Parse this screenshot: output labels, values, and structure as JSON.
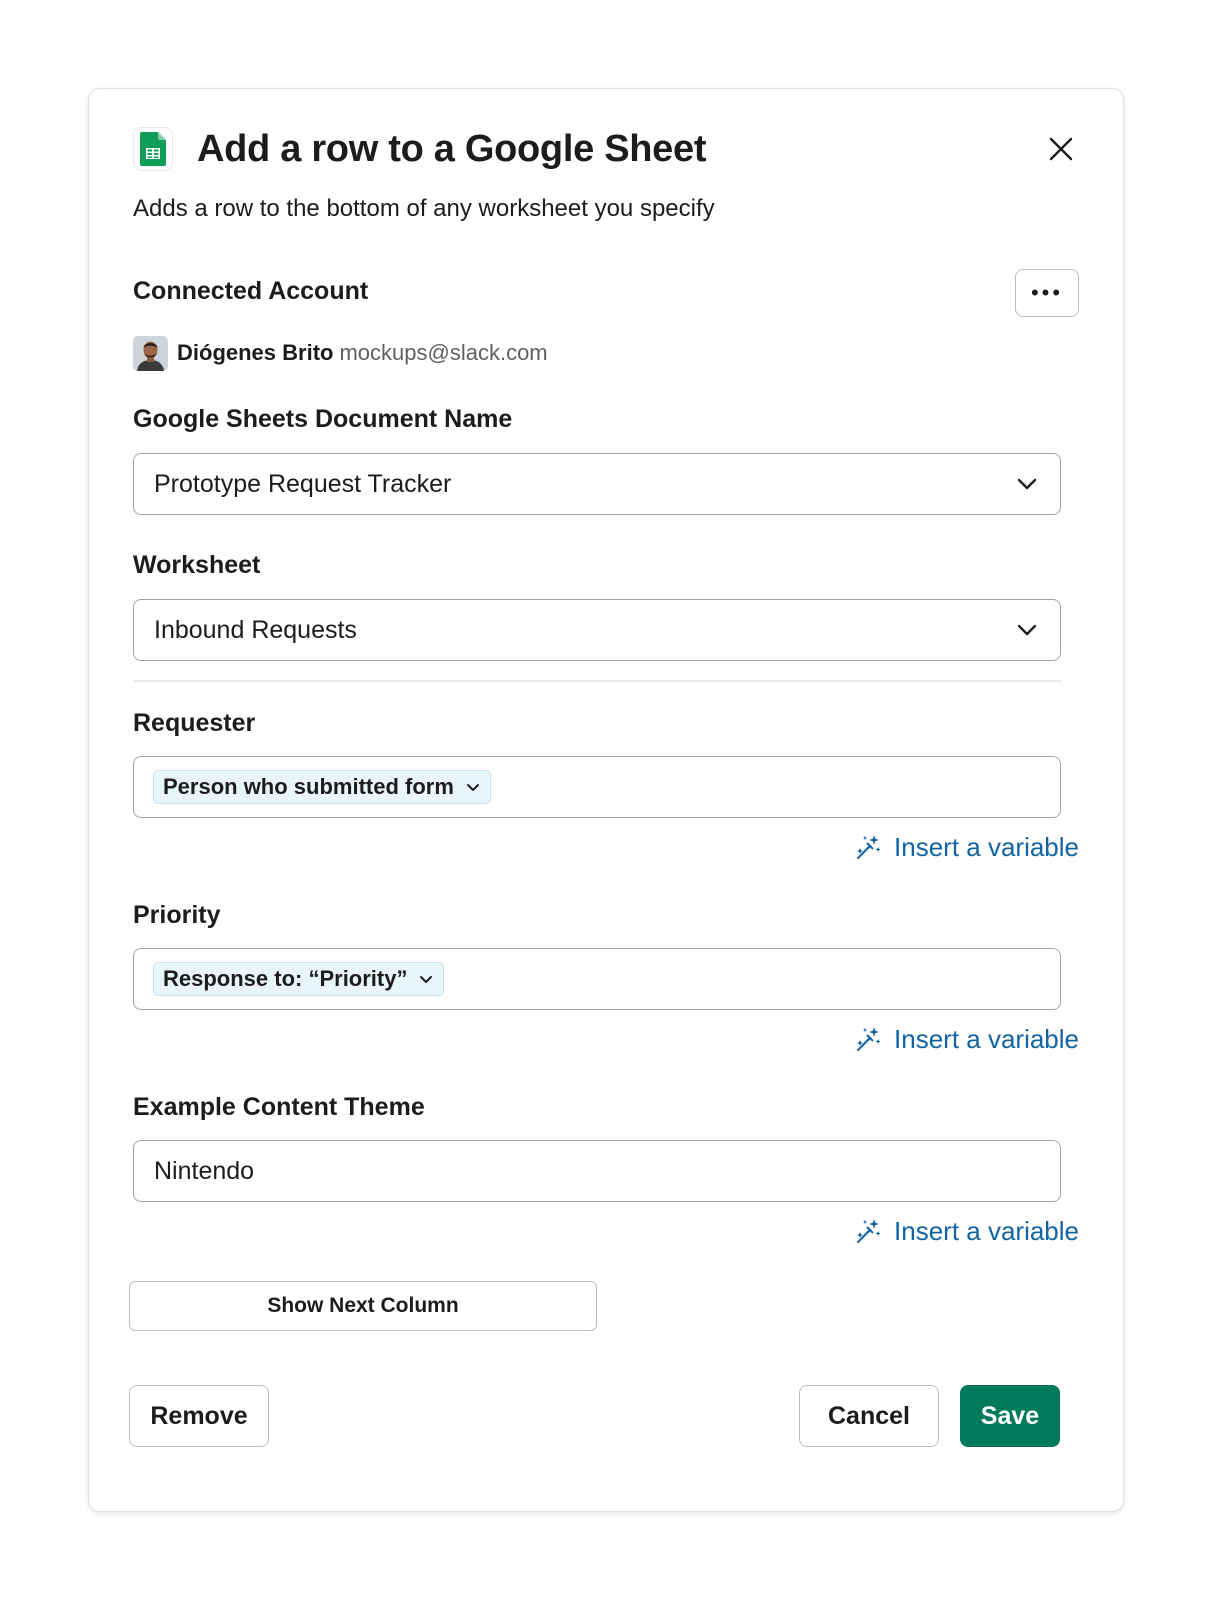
{
  "modal": {
    "title": "Add a row to a Google Sheet",
    "subtitle": "Adds a row to the bottom of any worksheet you specify",
    "app_icon": "google-sheets-icon",
    "close_icon": "close-icon"
  },
  "connected_account": {
    "label": "Connected Account",
    "more_label": "•••",
    "name": "Diógenes Brito",
    "email": "mockups@slack.com"
  },
  "document": {
    "label": "Google Sheets Document Name",
    "value": "Prototype Request Tracker"
  },
  "worksheet": {
    "label": "Worksheet",
    "value": "Inbound Requests"
  },
  "requester": {
    "label": "Requester",
    "token": "Person who submitted form"
  },
  "priority": {
    "label": "Priority",
    "token": "Response to: “Priority”"
  },
  "theme": {
    "label": "Example Content Theme",
    "value": "Nintendo"
  },
  "insert_variable_label": "Insert a variable",
  "show_next_label": "Show Next Column",
  "footer": {
    "remove_label": "Remove",
    "cancel_label": "Cancel",
    "save_label": "Save"
  },
  "colors": {
    "accent_link": "#1264a3",
    "save_button": "#007a5a",
    "sheets_green": "#0f9d58",
    "token_bg": "#e8f5fa"
  }
}
